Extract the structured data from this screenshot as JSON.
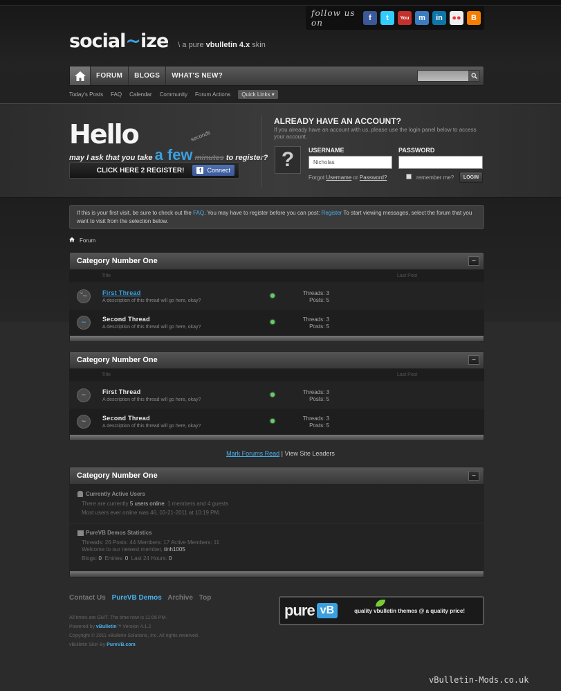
{
  "social": {
    "follow_label": "follow us on",
    "icons": [
      {
        "name": "facebook-icon",
        "glyph": "f",
        "color": "#3b5998"
      },
      {
        "name": "twitter-icon",
        "glyph": "t",
        "color": "#33ccff"
      },
      {
        "name": "youtube-icon",
        "glyph": "You",
        "color": "#c4302b"
      },
      {
        "name": "myspace-icon",
        "glyph": "m",
        "color": "#3b7bbf"
      },
      {
        "name": "linkedin-icon",
        "glyph": "in",
        "color": "#0e76a8"
      },
      {
        "name": "flickr-icon",
        "glyph": "●●",
        "color": "#eeeeee"
      },
      {
        "name": "blogger-icon",
        "glyph": "B",
        "color": "#f57d00"
      }
    ]
  },
  "logo": {
    "main": "social",
    "tilde": "~",
    "main2": "ize",
    "tag_prefix": "\\  a pure",
    "tag_bold": "vbulletin 4.x",
    "tag_suffix": "skin"
  },
  "nav": {
    "items": [
      "FORUM",
      "BLOGS",
      "WHAT'S NEW?"
    ],
    "search_icon": "search-icon"
  },
  "subnav": {
    "items": [
      "Today's Posts",
      "FAQ",
      "Calendar",
      "Community",
      "Forum Actions"
    ],
    "quick_links": "Quick Links ▾"
  },
  "hello": {
    "title": "Hello",
    "ask_prefix": "may I ask that you take",
    "a_few": "a few",
    "minutes": "minutes",
    "seconds": "seconds",
    "ask_suffix": "to register?",
    "register": "CLICK HERE 2 REGISTER!",
    "connect": "Connect"
  },
  "account": {
    "title": "ALREADY HAVE AN ACCOUNT?",
    "desc": "If you already have an account with us, please use the login panel below to access your account.",
    "username_label": "USERNAME",
    "password_label": "PASSWORD",
    "username_value": "Nicholas",
    "forgot_prefix": "Forgot",
    "forgot_user": "Username",
    "forgot_or": "or",
    "forgot_pass": "Password?",
    "remember": "remember me?",
    "login": "LOGIN"
  },
  "notice": {
    "p1": "If this is your first visit, be sure to check out the",
    "faq": "FAQ",
    "p2": ". You may have to register before you can post:",
    "register": "Register",
    "p3": "To start viewing messages, select the forum that you want to visit from the selection below."
  },
  "breadcrumb": {
    "label": "Forum"
  },
  "columns": {
    "title": "Title",
    "last_post": "Last Post"
  },
  "categories": [
    {
      "title": "Category Number One",
      "forums": [
        {
          "title": "First Thread",
          "desc": "A description of this thread will go here, okay?",
          "threads": "Threads: 3",
          "posts": "Posts: 5"
        },
        {
          "title": "Second Thread",
          "desc": "A description of this thread will go here, okay?",
          "threads": "Threads: 3",
          "posts": "Posts: 5"
        }
      ]
    },
    {
      "title": "Category Number One",
      "forums": [
        {
          "title": "First Thread",
          "desc": "A description of this thread will go here, okay?",
          "threads": "Threads: 3",
          "posts": "Posts: 5"
        },
        {
          "title": "Second Thread",
          "desc": "A description of this thread will go here, okay?",
          "threads": "Threads: 3",
          "posts": "Posts: 5"
        }
      ]
    }
  ],
  "mark": {
    "read": "Mark Forums Read",
    "sep": "|",
    "leaders": "View Site Leaders"
  },
  "wol": {
    "title": "Category Number One",
    "active_title": "Currently Active Users",
    "active_line1_a": "There are currently",
    "active_line1_b": "5 users online",
    "active_line1_c": ". 1 members and 4 guests",
    "active_line2": "Most users ever online was 46, 03-21-2011 at 10:19 PM.",
    "stats_title": "PureVB Demos Statistics",
    "stats_line1": "Threads: 26  Posts: 44  Members: 17  Active Members: 11",
    "stats_line2_a": "Welcome to our newest member,",
    "stats_line2_b": "tinh1005",
    "stats_line3_a": "Blogs:",
    "stats_line3_b": "0",
    "stats_line3_c": "Entries:",
    "stats_line3_d": "0",
    "stats_line3_e": "Last 24 Hours:",
    "stats_line3_f": "0"
  },
  "footer": {
    "links": [
      "Contact Us",
      "PureVB Demos",
      "Archive",
      "Top"
    ],
    "line1": "All times are GMT. The time now is 11:06 PM.",
    "line2_a": "Powered by",
    "line2_b": "vBulletin",
    "line2_c": "™ Version 4.1.2",
    "line3": "Copyright © 2011 vBulletin Solutions, Inc. All rights reserved.",
    "line4_a": "vBulletin Skin By",
    "line4_b": "PureVB.com",
    "banner_word": "pure",
    "banner_vb": "vB",
    "banner_tag": "quality vbulletin themes @ a quality price!"
  },
  "watermark": "vBulletin-Mods.co.uk"
}
